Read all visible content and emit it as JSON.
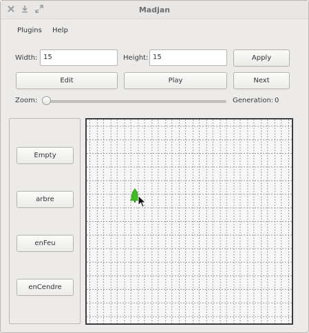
{
  "window": {
    "title": "Madjan",
    "controls": {
      "close": "close-icon",
      "minimize": "minimize-icon",
      "maximize": "maximize-icon"
    }
  },
  "menu": {
    "items": [
      {
        "label": "Plugins"
      },
      {
        "label": "Help"
      }
    ]
  },
  "size": {
    "width_label": "Width:",
    "width_value": "15",
    "height_label": "Height:",
    "height_value": "15",
    "apply_label": "Apply"
  },
  "controls": {
    "edit_label": "Edit",
    "play_label": "Play",
    "next_label": "Next"
  },
  "zoom": {
    "label": "Zoom:",
    "value": 0.0
  },
  "generation": {
    "label": "Generation:",
    "value": "0"
  },
  "states": [
    {
      "label": "Empty"
    },
    {
      "label": "arbre"
    },
    {
      "label": "enFeu"
    },
    {
      "label": "enCendre"
    }
  ],
  "grid": {
    "columns": 15,
    "rows": 15,
    "cells": [
      {
        "row": 5,
        "col": 3,
        "state": "arbre"
      }
    ],
    "colors": {
      "border": "#3c3c3c",
      "background": "#f7f7f7",
      "grid_line": "#9a9a9a",
      "tree": "#3fbf1f"
    }
  }
}
